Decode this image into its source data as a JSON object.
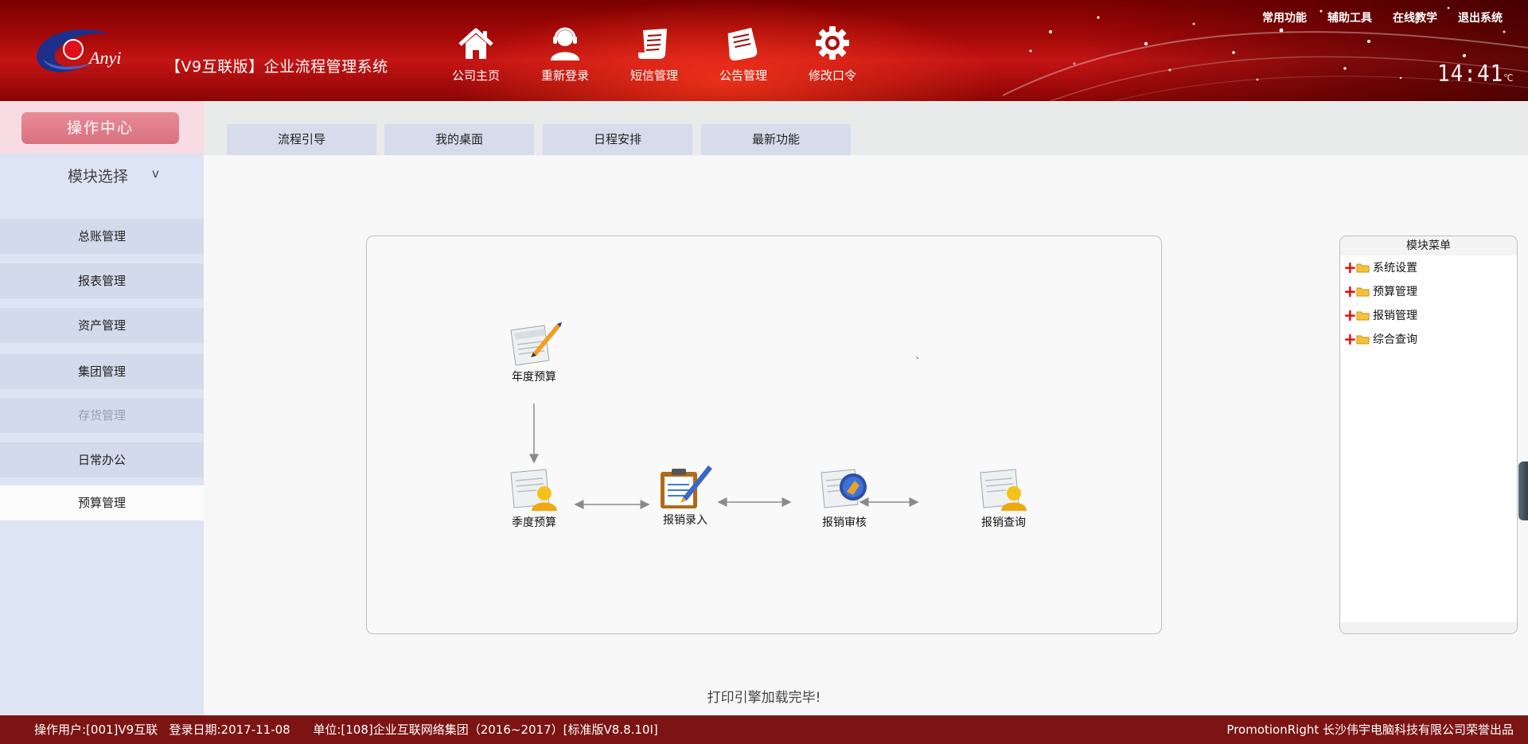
{
  "header": {
    "logo_text": "Anyi",
    "app_title": "【V9互联版】企业流程管理系统",
    "nav": [
      {
        "label": "公司主页",
        "icon": "home-icon"
      },
      {
        "label": "重新登录",
        "icon": "user-headset-icon"
      },
      {
        "label": "短信管理",
        "icon": "message-scroll-icon"
      },
      {
        "label": "公告管理",
        "icon": "notice-scroll-icon"
      },
      {
        "label": "修改口令",
        "icon": "gear-icon"
      }
    ],
    "top_menu": [
      "常用功能",
      "辅助工具",
      "在线教学",
      "退出系统"
    ],
    "clock": "14:41",
    "clock_unit": "℃"
  },
  "sidebar": {
    "op_center": "操作中心",
    "module_select": "模块选择",
    "module_select_chevron": "v",
    "items": [
      {
        "label": "总账管理",
        "state": "normal"
      },
      {
        "label": "报表管理",
        "state": "normal"
      },
      {
        "label": "资产管理",
        "state": "normal"
      },
      {
        "label": "集团管理",
        "state": "normal"
      },
      {
        "label": "存货管理",
        "state": "disabled"
      },
      {
        "label": "日常办公",
        "state": "normal"
      },
      {
        "label": "预算管理",
        "state": "active"
      }
    ]
  },
  "tabs": [
    "流程引导",
    "我的桌面",
    "日程安排",
    "最新功能"
  ],
  "flow": {
    "nodes": [
      {
        "label": "年度预算",
        "icon": "document-pen-icon"
      },
      {
        "label": "季度预算",
        "icon": "document-user-icon"
      },
      {
        "label": "报销录入",
        "icon": "clipboard-pen-icon"
      },
      {
        "label": "报销审核",
        "icon": "document-globe-icon"
      },
      {
        "label": "报销查询",
        "icon": "document-user-icon"
      }
    ]
  },
  "module_menu": {
    "title": "模块菜单",
    "items": [
      "系统设置",
      "预算管理",
      "报销管理",
      "综合查询"
    ]
  },
  "status_message": "打印引擎加载完毕!",
  "footer": {
    "left": "操作用户:[001]V9互联   登录日期:2017-11-08      单位:[108]企业互联网络集团（2016~2017）[标准版V8.8.10I]",
    "right": "PromotionRight 长沙伟宇电脑科技有限公司荣誉出品"
  },
  "colors": {
    "header_red": "#a40808",
    "footer_red": "#7c1414",
    "sidebar_bg": "#dde4f3",
    "op_center_pink": "#d9727f"
  }
}
